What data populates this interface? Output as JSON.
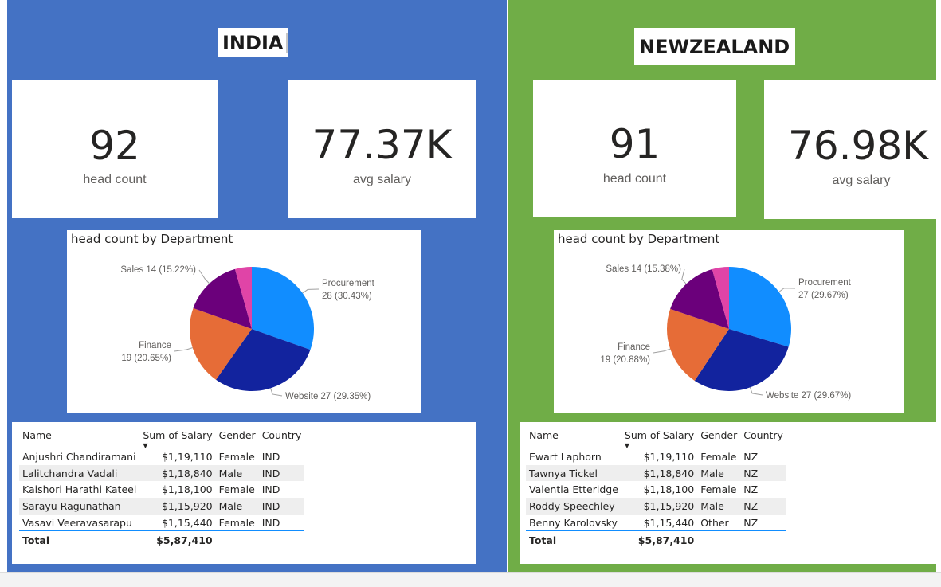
{
  "india": {
    "title": "INDIA",
    "head_count": "92",
    "head_count_label": "head count",
    "avg_salary": "77.37K",
    "avg_salary_label": "avg salary",
    "chart_title": "head count by Department",
    "table": {
      "columns": [
        "Name",
        "Sum of Salary",
        "Gender",
        "Country"
      ],
      "rows": [
        [
          "Anjushri Chandiramani",
          "$1,19,110",
          "Female",
          "IND"
        ],
        [
          "Lalitchandra Vadali",
          "$1,18,840",
          "Male",
          "IND"
        ],
        [
          "Kaishori Harathi Kateel",
          "$1,18,100",
          "Female",
          "IND"
        ],
        [
          "Sarayu Ragunathan",
          "$1,15,920",
          "Male",
          "IND"
        ],
        [
          "Vasavi Veeravasarapu",
          "$1,15,440",
          "Female",
          "IND"
        ]
      ],
      "total_label": "Total",
      "total_value": "$5,87,410"
    }
  },
  "nz": {
    "title": "NEWZEALAND",
    "head_count": "91",
    "head_count_label": "head count",
    "avg_salary": "76.98K",
    "avg_salary_label": "avg salary",
    "chart_title": "head count by Department",
    "table": {
      "columns": [
        "Name",
        "Sum of Salary",
        "Gender",
        "Country"
      ],
      "rows": [
        [
          "Ewart Laphorn",
          "$1,19,110",
          "Female",
          "NZ"
        ],
        [
          "Tawnya Tickel",
          "$1,18,840",
          "Male",
          "NZ"
        ],
        [
          "Valentia Etteridge",
          "$1,18,100",
          "Female",
          "NZ"
        ],
        [
          "Roddy Speechley",
          "$1,15,920",
          "Male",
          "NZ"
        ],
        [
          "Benny Karolovsky",
          "$1,15,440",
          "Other",
          "NZ"
        ]
      ],
      "total_label": "Total",
      "total_value": "$5,87,410"
    }
  },
  "chart_data": [
    {
      "type": "pie",
      "title": "head count by Department",
      "categories": [
        "Procurement",
        "Website",
        "Finance",
        "Sales",
        ""
      ],
      "values": [
        28,
        27,
        19,
        14,
        4
      ],
      "labels": [
        "Procurement 28 (30.43%)",
        "Website 27 (29.35%)",
        "Finance 19 (20.65%)",
        "Sales 14 (15.22%)",
        ""
      ],
      "label_lines": [
        [
          "Procurement",
          "28 (30.43%)"
        ],
        [
          "Website 27 (29.35%)"
        ],
        [
          "Finance",
          "19 (20.65%)"
        ],
        [
          "Sales 14 (15.22%)"
        ],
        []
      ],
      "colors": [
        "#118dff",
        "#12239e",
        "#e66c37",
        "#6b007b",
        "#e044a7"
      ]
    },
    {
      "type": "pie",
      "title": "head count by Department",
      "categories": [
        "Procurement",
        "Website",
        "Finance",
        "Sales",
        ""
      ],
      "values": [
        27,
        27,
        19,
        14,
        4
      ],
      "labels": [
        "Procurement 27 (29.67%)",
        "Website 27 (29.67%)",
        "Finance 19 (20.88%)",
        "Sales 14 (15.38%)",
        ""
      ],
      "label_lines": [
        [
          "Procurement",
          "27 (29.67%)"
        ],
        [
          "Website 27 (29.67%)"
        ],
        [
          "Finance",
          "19 (20.88%)"
        ],
        [
          "Sales 14 (15.38%)"
        ],
        []
      ],
      "colors": [
        "#118dff",
        "#12239e",
        "#e66c37",
        "#6b007b",
        "#e044a7"
      ]
    }
  ]
}
